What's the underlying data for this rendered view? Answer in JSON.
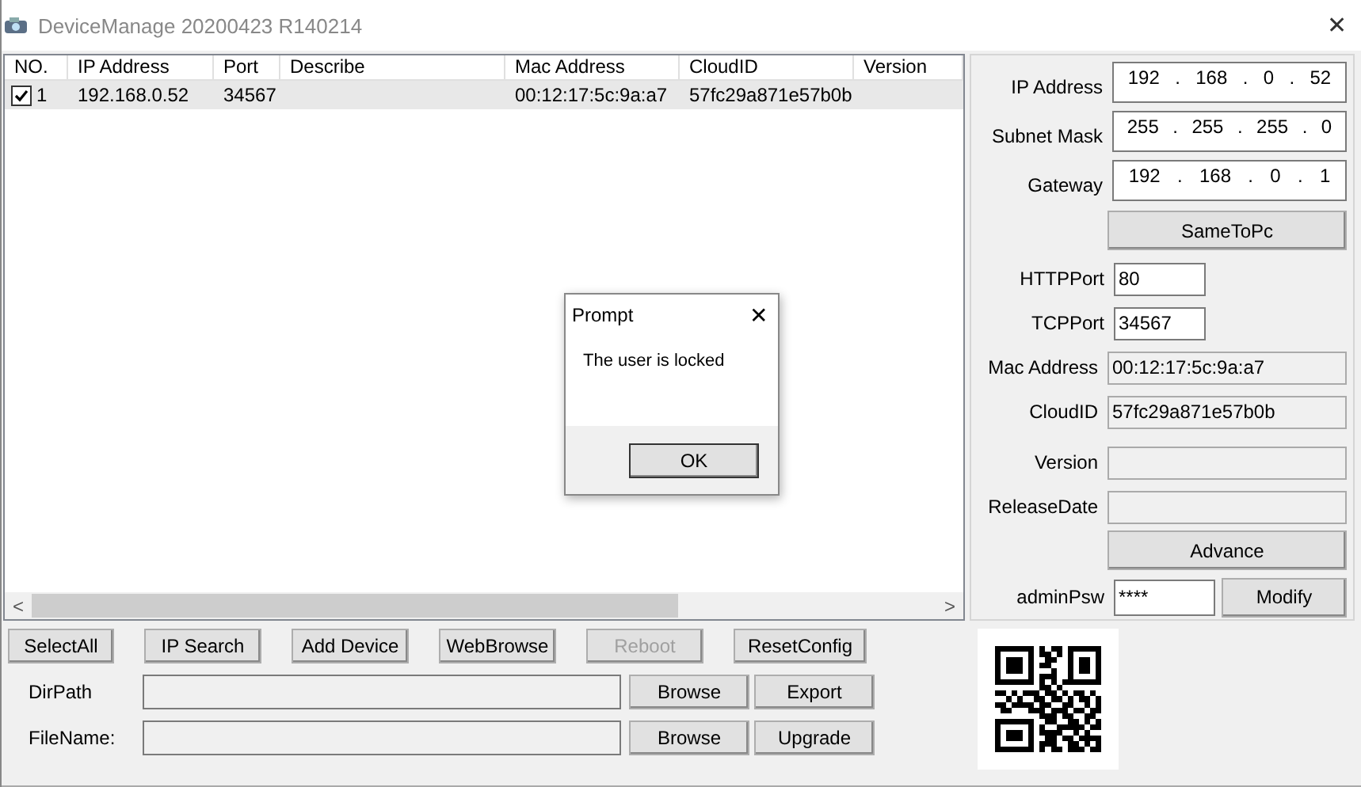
{
  "window": {
    "title": "DeviceManage 20200423 R140214",
    "close": "✕"
  },
  "table": {
    "columns": [
      "NO.",
      "IP Address",
      "Port",
      "Describe",
      "Mac Address",
      "CloudID",
      "Version"
    ],
    "rows": [
      {
        "checked": true,
        "selected": true,
        "cells": [
          "1",
          "192.168.0.52",
          "34567",
          "",
          "00:12:17:5c:9a:a7",
          "57fc29a871e57b0b",
          ""
        ]
      }
    ],
    "scroll_left": "<",
    "scroll_right": ">"
  },
  "settings": [
    {
      "kind": "ip",
      "label": "IP Address",
      "octets": [
        "192",
        "168",
        "0",
        "52"
      ],
      "separator": "."
    },
    {
      "kind": "ip",
      "label": "Subnet Mask",
      "octets": [
        "255",
        "255",
        "255",
        "0"
      ],
      "separator": "."
    },
    {
      "kind": "ip",
      "label": "Gateway",
      "octets": [
        "192",
        "168",
        "0",
        "1"
      ],
      "separator": "."
    },
    {
      "kind": "button",
      "label": "SameToPc"
    },
    {
      "kind": "short",
      "label": "HTTPPort",
      "value": "80"
    },
    {
      "kind": "short",
      "label": "TCPPort",
      "value": "34567"
    },
    {
      "kind": "readonly",
      "label": "Mac Address",
      "value": "00:12:17:5c:9a:a7"
    },
    {
      "kind": "readonly",
      "label": "CloudID",
      "value": "57fc29a871e57b0b"
    },
    {
      "kind": "readonly",
      "label": "Version"
    },
    {
      "kind": "readonly",
      "label": "ReleaseDate"
    },
    {
      "kind": "button",
      "label": "Advance"
    },
    {
      "kind": "password",
      "label": "adminPsw",
      "value": "****",
      "button": "Modify"
    }
  ],
  "actions": [
    {
      "label": "SelectAll",
      "disabled": false
    },
    {
      "label": "IP Search",
      "disabled": false
    },
    {
      "label": "Add Device",
      "disabled": false
    },
    {
      "label": "WebBrowse",
      "disabled": false
    },
    {
      "label": "Reboot",
      "disabled": true
    },
    {
      "label": "ResetConfig",
      "disabled": false
    }
  ],
  "paths": [
    {
      "label": "DirPath",
      "buttons": [
        "Browse",
        "Export"
      ]
    },
    {
      "label": "FileName:",
      "buttons": [
        "Browse",
        "Upgrade"
      ]
    }
  ],
  "dialog": {
    "title": "Prompt",
    "close": "✕",
    "message": "The user is locked",
    "button": "OK"
  }
}
